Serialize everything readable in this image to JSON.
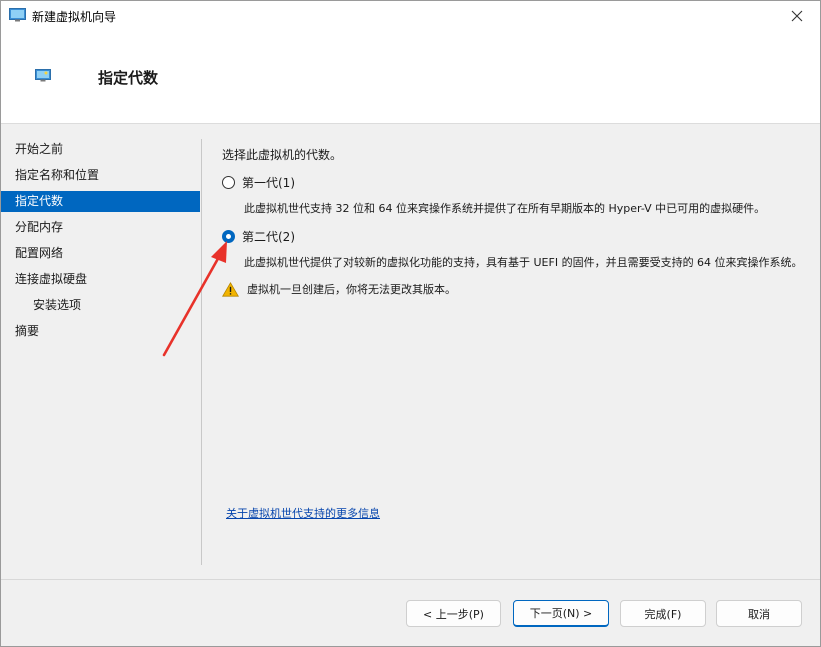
{
  "window": {
    "title": "新建虚拟机向导",
    "close_glyph": "✕"
  },
  "header": {
    "title": "指定代数"
  },
  "nav": {
    "items": [
      {
        "label": "开始之前",
        "active": false,
        "sub": false
      },
      {
        "label": "指定名称和位置",
        "active": false,
        "sub": false
      },
      {
        "label": "指定代数",
        "active": true,
        "sub": false
      },
      {
        "label": "分配内存",
        "active": false,
        "sub": false
      },
      {
        "label": "配置网络",
        "active": false,
        "sub": false
      },
      {
        "label": "连接虚拟硬盘",
        "active": false,
        "sub": false
      },
      {
        "label": "安装选项",
        "active": false,
        "sub": true
      },
      {
        "label": "摘要",
        "active": false,
        "sub": false
      }
    ]
  },
  "main": {
    "prompt": "选择此虚拟机的代数。",
    "options": [
      {
        "label": "第一代(1)",
        "checked": false,
        "description": "此虚拟机世代支持 32 位和 64 位来宾操作系统并提供了在所有早期版本的 Hyper-V 中已可用的虚拟硬件。"
      },
      {
        "label": "第二代(2)",
        "checked": true,
        "description": "此虚拟机世代提供了对较新的虚拟化功能的支持，具有基于 UEFI 的固件，并且需要受支持的 64 位来宾操作系统。"
      }
    ],
    "warning": "虚拟机一旦创建后，你将无法更改其版本。",
    "more_info_link": "关于虚拟机世代支持的更多信息"
  },
  "footer": {
    "back_label": "< 上一步(P)",
    "next_label": "下一页(N) >",
    "finish_label": "完成(F)",
    "cancel_label": "取消"
  },
  "colors": {
    "accent": "#0067c0",
    "annotation_arrow": "#e8322a",
    "warning": "#f2b400",
    "link": "#0645ad"
  },
  "icons": {
    "app": "hyper-v-monitor-icon",
    "close": "close-icon",
    "warning": "warning-icon"
  }
}
